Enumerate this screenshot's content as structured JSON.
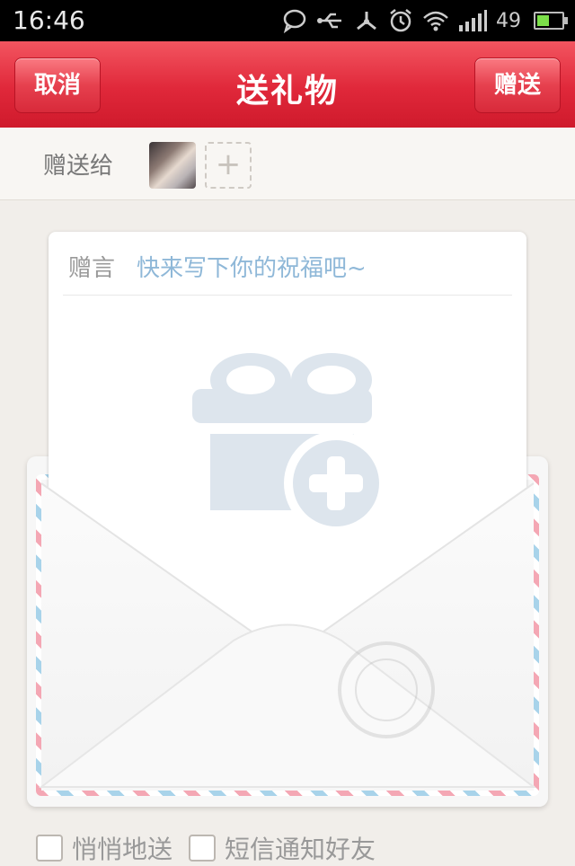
{
  "status_bar": {
    "time": "16:46",
    "battery_level": "49",
    "battery_fill": 0.49,
    "icons": [
      "chat-bubble-icon",
      "usb-icon",
      "share-icon",
      "alarm-icon",
      "wifi-icon",
      "signal-icon",
      "battery-icon"
    ]
  },
  "header": {
    "title": "送礼物",
    "cancel_label": "取消",
    "send_label": "赠送"
  },
  "recipient": {
    "label": "赠送给",
    "add_icon": "+"
  },
  "letter": {
    "message_label": "赠言",
    "message_placeholder": "快来写下你的祝福吧~"
  },
  "options": {
    "secret_send_label": "悄悄地送",
    "sms_notify_label": "短信通知好友"
  },
  "colors": {
    "accent_red": "#e0283a",
    "placeholder_blue": "#8fb8d8",
    "gift_icon": "#dde5ed"
  }
}
